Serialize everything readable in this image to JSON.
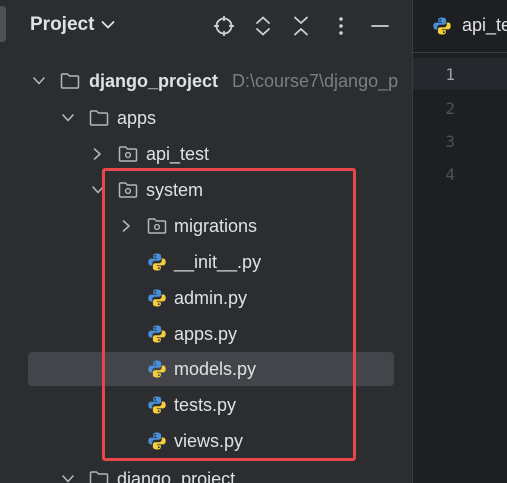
{
  "panel": {
    "title": "Project"
  },
  "tree": [
    {
      "label": "django_project",
      "path": "D:\\course7\\django_p",
      "kind": "folder",
      "expanded": true,
      "bold": true
    },
    {
      "label": "apps",
      "kind": "folder",
      "expanded": true
    },
    {
      "label": "api_test",
      "kind": "package",
      "expanded": false
    },
    {
      "label": "system",
      "kind": "package",
      "expanded": true
    },
    {
      "label": "migrations",
      "kind": "package",
      "expanded": false
    },
    {
      "label": "__init__.py",
      "kind": "python-file"
    },
    {
      "label": "admin.py",
      "kind": "python-file"
    },
    {
      "label": "apps.py",
      "kind": "python-file"
    },
    {
      "label": "models.py",
      "kind": "python-file",
      "selected": true
    },
    {
      "label": "tests.py",
      "kind": "python-file"
    },
    {
      "label": "views.py",
      "kind": "python-file"
    },
    {
      "label": "django_project",
      "kind": "folder",
      "expanded": true
    }
  ],
  "editor": {
    "tab_label": "api_te",
    "line_numbers": [
      "1",
      "2",
      "3",
      "4"
    ]
  },
  "colors": {
    "panel_bg": "#2b2d30",
    "editor_bg": "#1e1f22",
    "highlight_box": "#e8464b",
    "selection": "#43454a",
    "text": "#dfe1e5",
    "muted_text": "#7b7e85"
  },
  "icons": {
    "header": [
      "crosshair-icon",
      "expand-all-icon",
      "collapse-all-icon",
      "more-icon",
      "minimize-icon"
    ],
    "folder": "folder-icon",
    "package": "package-icon",
    "python_file": "python-icon"
  }
}
